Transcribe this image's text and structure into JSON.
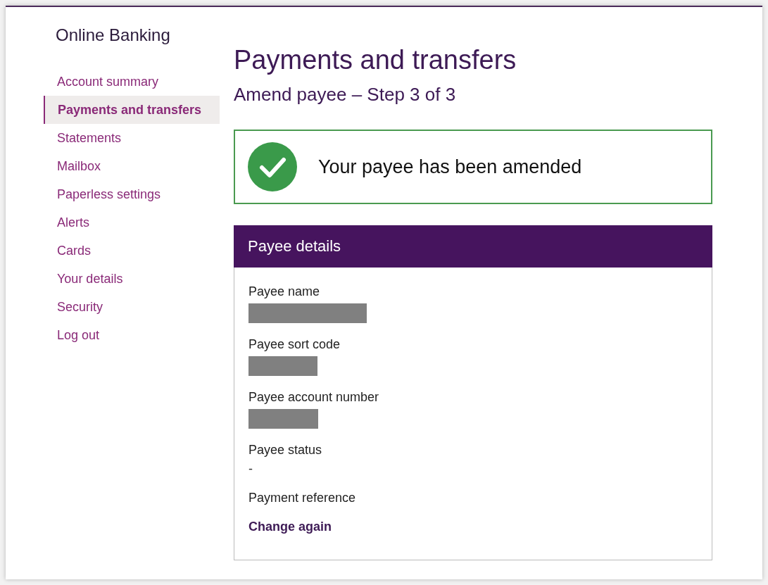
{
  "sidebar": {
    "title": "Online Banking",
    "items": [
      {
        "label": "Account summary",
        "selected": false
      },
      {
        "label": "Payments and transfers",
        "selected": true
      },
      {
        "label": "Statements",
        "selected": false
      },
      {
        "label": "Mailbox",
        "selected": false
      },
      {
        "label": "Paperless settings",
        "selected": false
      },
      {
        "label": "Alerts",
        "selected": false
      },
      {
        "label": "Cards",
        "selected": false
      },
      {
        "label": "Your details",
        "selected": false
      },
      {
        "label": "Security",
        "selected": false
      },
      {
        "label": "Log out",
        "selected": false
      }
    ]
  },
  "page_title": "Payments and transfers",
  "subtitle": "Amend payee – Step 3 of 3",
  "success_message": "Your payee has been amended",
  "details": {
    "heading": "Payee details",
    "fields": [
      {
        "label": "Payee name",
        "kind": "redacted"
      },
      {
        "label": "Payee sort code",
        "kind": "redacted"
      },
      {
        "label": "Payee account number",
        "kind": "redacted"
      },
      {
        "label": "Payee status",
        "kind": "text",
        "value": "-"
      },
      {
        "label": "Payment reference",
        "kind": "empty"
      }
    ],
    "link": "Change again"
  }
}
